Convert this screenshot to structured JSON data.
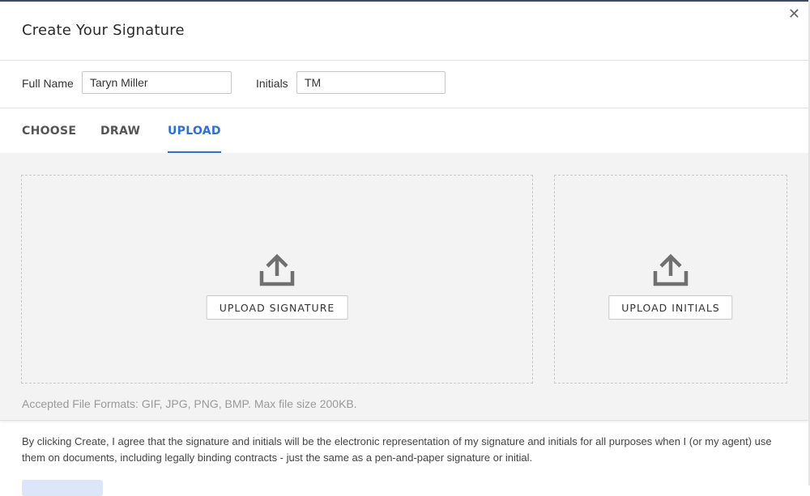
{
  "dialog": {
    "title": "Create Your Signature",
    "close_icon": "close-icon"
  },
  "names": {
    "full_name_label": "Full Name",
    "full_name_value": "Taryn Miller",
    "initials_label": "Initials",
    "initials_value": "TM"
  },
  "tabs": [
    {
      "label": "CHOOSE",
      "active": false
    },
    {
      "label": "DRAW",
      "active": false
    },
    {
      "label": "UPLOAD",
      "active": true
    }
  ],
  "upload": {
    "signature_button": "UPLOAD SIGNATURE",
    "initials_button": "UPLOAD INITIALS",
    "icon": "upload-icon",
    "formats_note": "Accepted File Formats: GIF, JPG, PNG, BMP. Max file size 200KB."
  },
  "footer": {
    "legal_text": "By clicking Create, I agree that the signature and initials will be the electronic representation of my signature and initials for all purposes when I (or my agent) use them on documents, including legally binding contracts - just the same as a pen-and-paper signature or initial.",
    "create_button": ""
  },
  "colors": {
    "accent": "#2f6fd6",
    "body_bg": "#f3f3f3"
  }
}
